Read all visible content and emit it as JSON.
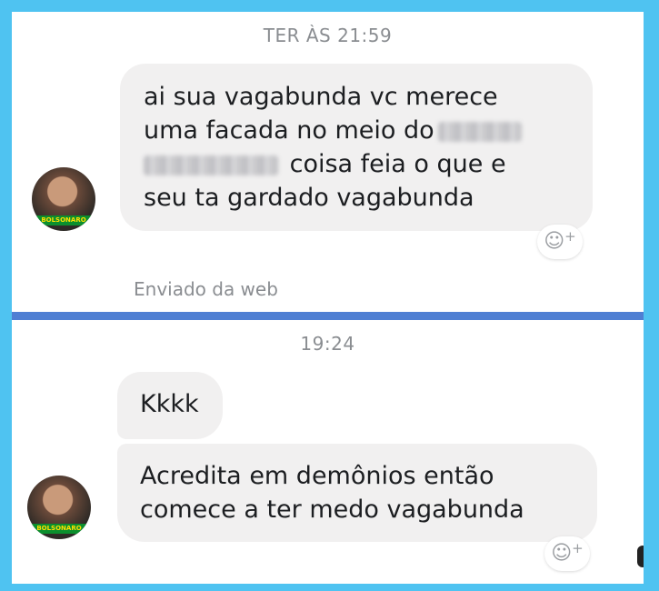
{
  "top": {
    "timestamp": "TER ÀS 21:59",
    "message_lines": [
      "ai sua vagabunda vc merece",
      "uma facada no meio do",
      "coisa feia o que e",
      "seu ta gardado vagabunda"
    ],
    "reaction_icon": "smiley-plus-icon",
    "sent_via": "Enviado da web"
  },
  "bottom": {
    "timestamp": "19:24",
    "message1": "Kkkk",
    "message2_lines": [
      "Acredita em demônios então",
      "comece a ter medo vagabunda"
    ],
    "reaction_icon": "smiley-plus-icon"
  },
  "avatar": {
    "banner_text": "BOLSONARO"
  },
  "colors": {
    "frame": "#4fc3f1",
    "divider": "#4f7fd3",
    "bubble": "#f1f0f0",
    "muted_text": "#8a8d91"
  }
}
